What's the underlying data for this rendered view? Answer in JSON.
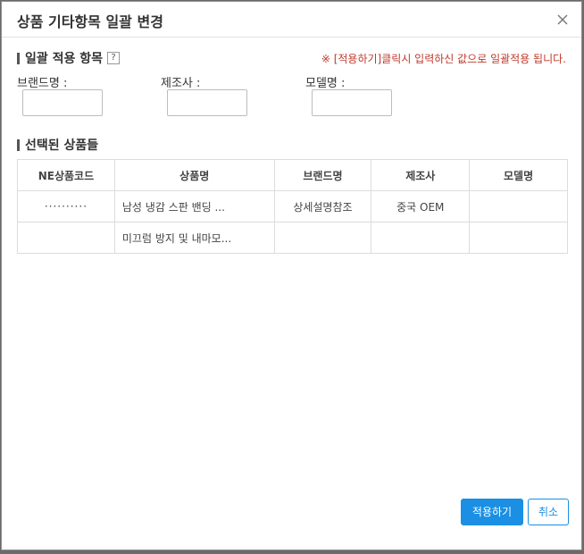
{
  "dialog": {
    "title": "상품 기타항목 일괄 변경",
    "close_icon": "close-icon"
  },
  "bulk_section": {
    "heading": "일괄 적용 항목",
    "help_symbol": "?",
    "notice": "※ [적용하기]클릭시 입력하신 값으로 일괄적용 됩니다.",
    "fields": [
      {
        "label": "브랜드명 :",
        "value": ""
      },
      {
        "label": "제조사 :",
        "value": ""
      },
      {
        "label": "모델명 :",
        "value": ""
      }
    ]
  },
  "selected_section": {
    "heading": "선택된 상품들",
    "columns": [
      "NE상품코드",
      "상품명",
      "브랜드명",
      "제조사",
      "모델명"
    ],
    "rows": [
      {
        "code": "··········",
        "name": "남성 냉감 스판 밴딩 ...",
        "brand": "상세설명참조",
        "maker": "중국 OEM",
        "model": ""
      },
      {
        "code": "",
        "name": "미끄럼 방지 및 내마모...",
        "brand": "",
        "maker": "",
        "model": ""
      }
    ]
  },
  "footer": {
    "apply_label": "적용하기",
    "cancel_label": "취소"
  },
  "colors": {
    "primary": "#1a8fe3",
    "notice": "#c0392b"
  }
}
